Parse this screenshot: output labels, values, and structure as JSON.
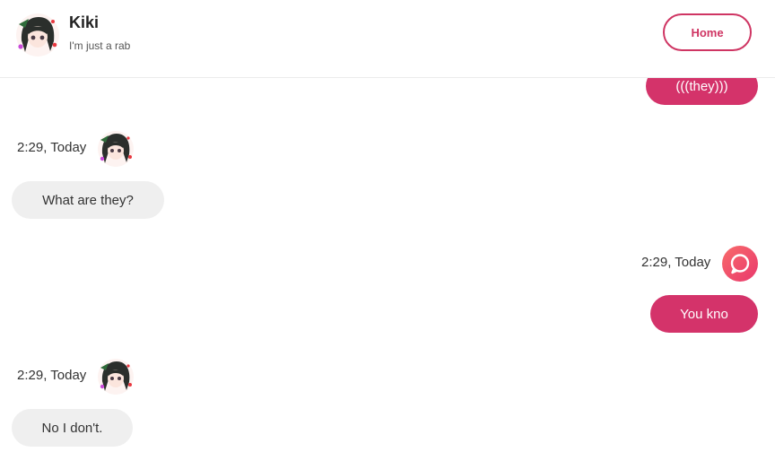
{
  "header": {
    "name": "Kiki",
    "status": "I'm just a rab",
    "home_label": "Home"
  },
  "messages": [
    {
      "direction": "out",
      "text": "(((they)))"
    },
    {
      "direction": "in",
      "time": "2:29, Today",
      "text": "What are they?"
    },
    {
      "direction": "out",
      "time": "2:29, Today",
      "text": "You kno"
    },
    {
      "direction": "in",
      "time": "2:29, Today",
      "text": "No I don't."
    }
  ],
  "icons": {
    "bot_avatar": "anime-girl-avatar",
    "user_avatar": "chat-bubble-icon"
  },
  "colors": {
    "accent": "#cf3563",
    "outgoing_bubble": "#d4336a",
    "incoming_bubble": "#efefef"
  }
}
